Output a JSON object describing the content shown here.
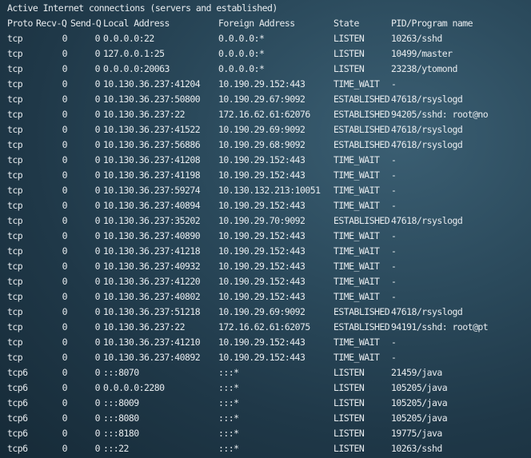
{
  "title": "Active Internet connections (servers and established)",
  "columns": {
    "proto": "Proto",
    "recvq": "Recv-Q",
    "sendq": "Send-Q",
    "local": "Local Address",
    "foreign": "Foreign Address",
    "state": "State",
    "pid": "PID/Program name"
  },
  "connections": [
    {
      "proto": "tcp",
      "recvq": "0",
      "sendq": "0",
      "local": "0.0.0.0:22",
      "foreign": "0.0.0.0:*",
      "state": "LISTEN",
      "pid": "10263/sshd"
    },
    {
      "proto": "tcp",
      "recvq": "0",
      "sendq": "0",
      "local": "127.0.0.1:25",
      "foreign": "0.0.0.0:*",
      "state": "LISTEN",
      "pid": "10499/master"
    },
    {
      "proto": "tcp",
      "recvq": "0",
      "sendq": "0",
      "local": "0.0.0.0:20063",
      "foreign": "0.0.0.0:*",
      "state": "LISTEN",
      "pid": "23238/ytomond"
    },
    {
      "proto": "tcp",
      "recvq": "0",
      "sendq": "0",
      "local": "10.130.36.237:41204",
      "foreign": "10.190.29.152:443",
      "state": "TIME_WAIT",
      "pid": "-"
    },
    {
      "proto": "tcp",
      "recvq": "0",
      "sendq": "0",
      "local": "10.130.36.237:50800",
      "foreign": "10.190.29.67:9092",
      "state": "ESTABLISHED",
      "pid": "47618/rsyslogd"
    },
    {
      "proto": "tcp",
      "recvq": "0",
      "sendq": "0",
      "local": "10.130.36.237:22",
      "foreign": "172.16.62.61:62076",
      "state": "ESTABLISHED",
      "pid": "94205/sshd: root@no"
    },
    {
      "proto": "tcp",
      "recvq": "0",
      "sendq": "0",
      "local": "10.130.36.237:41522",
      "foreign": "10.190.29.69:9092",
      "state": "ESTABLISHED",
      "pid": "47618/rsyslogd"
    },
    {
      "proto": "tcp",
      "recvq": "0",
      "sendq": "0",
      "local": "10.130.36.237:56886",
      "foreign": "10.190.29.68:9092",
      "state": "ESTABLISHED",
      "pid": "47618/rsyslogd"
    },
    {
      "proto": "tcp",
      "recvq": "0",
      "sendq": "0",
      "local": "10.130.36.237:41208",
      "foreign": "10.190.29.152:443",
      "state": "TIME_WAIT",
      "pid": "-"
    },
    {
      "proto": "tcp",
      "recvq": "0",
      "sendq": "0",
      "local": "10.130.36.237:41198",
      "foreign": "10.190.29.152:443",
      "state": "TIME_WAIT",
      "pid": "-"
    },
    {
      "proto": "tcp",
      "recvq": "0",
      "sendq": "0",
      "local": "10.130.36.237:59274",
      "foreign": "10.130.132.213:10051",
      "state": "TIME_WAIT",
      "pid": "-"
    },
    {
      "proto": "tcp",
      "recvq": "0",
      "sendq": "0",
      "local": "10.130.36.237:40894",
      "foreign": "10.190.29.152:443",
      "state": "TIME_WAIT",
      "pid": "-"
    },
    {
      "proto": "tcp",
      "recvq": "0",
      "sendq": "0",
      "local": "10.130.36.237:35202",
      "foreign": "10.190.29.70:9092",
      "state": "ESTABLISHED",
      "pid": "47618/rsyslogd"
    },
    {
      "proto": "tcp",
      "recvq": "0",
      "sendq": "0",
      "local": "10.130.36.237:40890",
      "foreign": "10.190.29.152:443",
      "state": "TIME_WAIT",
      "pid": "-"
    },
    {
      "proto": "tcp",
      "recvq": "0",
      "sendq": "0",
      "local": "10.130.36.237:41218",
      "foreign": "10.190.29.152:443",
      "state": "TIME_WAIT",
      "pid": "-"
    },
    {
      "proto": "tcp",
      "recvq": "0",
      "sendq": "0",
      "local": "10.130.36.237:40932",
      "foreign": "10.190.29.152:443",
      "state": "TIME_WAIT",
      "pid": "-"
    },
    {
      "proto": "tcp",
      "recvq": "0",
      "sendq": "0",
      "local": "10.130.36.237:41220",
      "foreign": "10.190.29.152:443",
      "state": "TIME_WAIT",
      "pid": "-"
    },
    {
      "proto": "tcp",
      "recvq": "0",
      "sendq": "0",
      "local": "10.130.36.237:40802",
      "foreign": "10.190.29.152:443",
      "state": "TIME_WAIT",
      "pid": "-"
    },
    {
      "proto": "tcp",
      "recvq": "0",
      "sendq": "0",
      "local": "10.130.36.237:51218",
      "foreign": "10.190.29.69:9092",
      "state": "ESTABLISHED",
      "pid": "47618/rsyslogd"
    },
    {
      "proto": "tcp",
      "recvq": "0",
      "sendq": "0",
      "local": "10.130.36.237:22",
      "foreign": "172.16.62.61:62075",
      "state": "ESTABLISHED",
      "pid": "94191/sshd: root@pt"
    },
    {
      "proto": "tcp",
      "recvq": "0",
      "sendq": "0",
      "local": "10.130.36.237:41210",
      "foreign": "10.190.29.152:443",
      "state": "TIME_WAIT",
      "pid": "-"
    },
    {
      "proto": "tcp",
      "recvq": "0",
      "sendq": "0",
      "local": "10.130.36.237:40892",
      "foreign": "10.190.29.152:443",
      "state": "TIME_WAIT",
      "pid": "-"
    },
    {
      "proto": "tcp6",
      "recvq": "0",
      "sendq": "0",
      "local": ":::8070",
      "foreign": ":::*",
      "state": "LISTEN",
      "pid": "21459/java"
    },
    {
      "proto": "tcp6",
      "recvq": "0",
      "sendq": "0",
      "local": "0.0.0.0:2280",
      "foreign": ":::*",
      "state": "LISTEN",
      "pid": "105205/java"
    },
    {
      "proto": "tcp6",
      "recvq": "0",
      "sendq": "0",
      "local": ":::8009",
      "foreign": ":::*",
      "state": "LISTEN",
      "pid": "105205/java"
    },
    {
      "proto": "tcp6",
      "recvq": "0",
      "sendq": "0",
      "local": ":::8080",
      "foreign": ":::*",
      "state": "LISTEN",
      "pid": "105205/java"
    },
    {
      "proto": "tcp6",
      "recvq": "0",
      "sendq": "0",
      "local": ":::8180",
      "foreign": ":::*",
      "state": "LISTEN",
      "pid": "19775/java"
    },
    {
      "proto": "tcp6",
      "recvq": "0",
      "sendq": "0",
      "local": ":::22",
      "foreign": ":::*",
      "state": "LISTEN",
      "pid": "10263/sshd"
    }
  ]
}
